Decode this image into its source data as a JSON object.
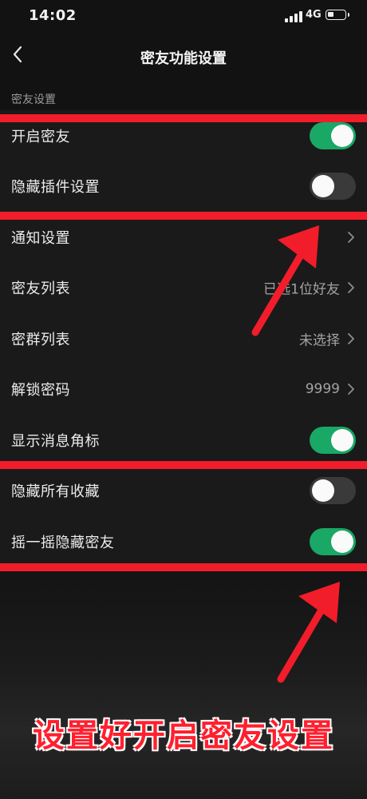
{
  "status_bar": {
    "time": "14:02",
    "network": "4G"
  },
  "nav": {
    "title": "密友功能设置"
  },
  "section": {
    "label": "密友设置"
  },
  "rows": [
    {
      "label": "开启密友",
      "type": "toggle",
      "on": true
    },
    {
      "label": "隐藏插件设置",
      "type": "toggle",
      "on": false
    },
    {
      "label": "通知设置",
      "type": "link",
      "value": ""
    },
    {
      "label": "密友列表",
      "type": "link",
      "value": "已选1位好友"
    },
    {
      "label": "密群列表",
      "type": "link",
      "value": "未选择"
    },
    {
      "label": "解锁密码",
      "type": "link",
      "value": "9999"
    },
    {
      "label": "显示消息角标",
      "type": "toggle",
      "on": true
    },
    {
      "label": "隐藏所有收藏",
      "type": "toggle",
      "on": false
    },
    {
      "label": "摇一摇隐藏密友",
      "type": "toggle",
      "on": true
    }
  ],
  "caption": "设置好开启密友设置",
  "colors": {
    "toggle_on": "#19a865",
    "annotation_red": "#f21d2b"
  },
  "icons": {
    "back": "chevron-left-icon",
    "row_chevron": "chevron-right-icon"
  }
}
